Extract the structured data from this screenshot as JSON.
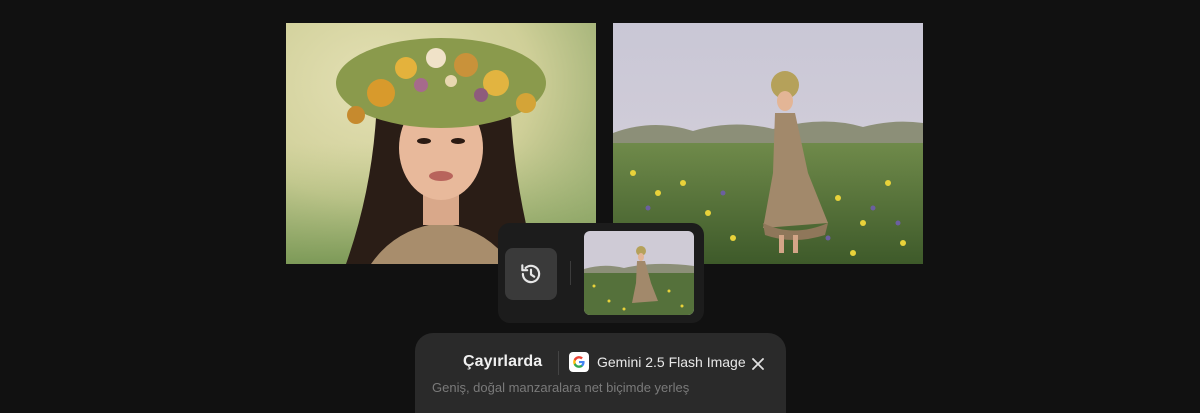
{
  "gallery": {
    "images": [
      {
        "subject": "woman-with-flower-crown-portrait"
      },
      {
        "subject": "woman-in-flower-meadow"
      }
    ]
  },
  "history": {
    "icon": "history-icon"
  },
  "prompt": {
    "title": "Çayırlarda",
    "model": {
      "icon": "google-icon",
      "name": "Gemini 2.5 Flash Image"
    },
    "close_icon": "close-icon",
    "description": "Geniş, doğal manzaralara net biçimde yerleş"
  },
  "colors": {
    "background": "#111111",
    "panel": "#2a2a2a",
    "history_bar": "#1c1c1c",
    "history_button": "#3a3a3a"
  }
}
